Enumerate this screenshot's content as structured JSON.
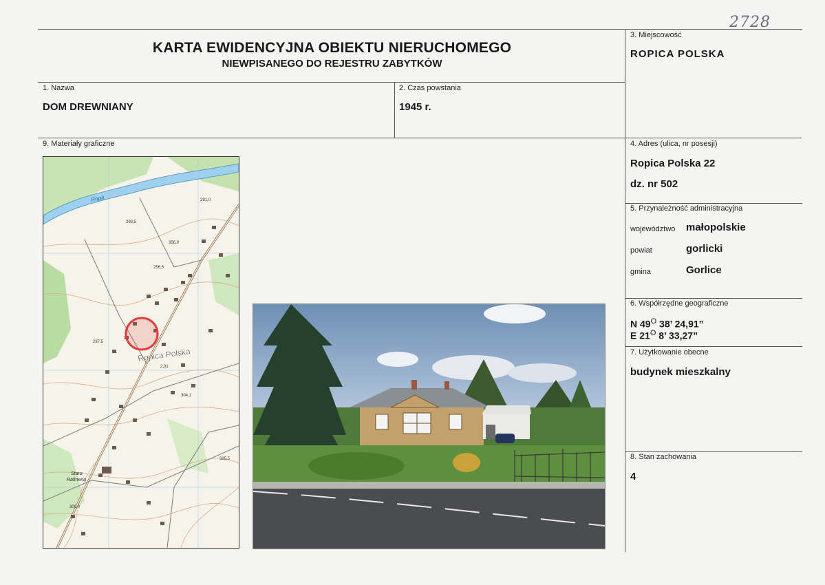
{
  "header": {
    "handwritten_number": "2728",
    "title_line1": "KARTA EWIDENCYJNA OBIEKTU NIERUCHOMEGO",
    "title_line2": "NIEWPISANEGO DO REJESTRU ZABYTKÓW"
  },
  "fields": {
    "miejscowosc": {
      "label": "3. Miejscowość",
      "value": "ROPICA POLSKA"
    },
    "nazwa": {
      "label": "1. Nazwa",
      "value": "DOM DREWNIANY"
    },
    "czas_powstania": {
      "label": "2. Czas powstania",
      "value": "1945 r."
    },
    "materialy": {
      "label": "9. Materiały graficzne"
    },
    "adres": {
      "label": "4. Adres (ulica, nr posesji)",
      "line1": "Ropica Polska 22",
      "line2": "dz. nr 502"
    },
    "przynaleznosc": {
      "label": "5. Przynależność administracyjna",
      "wojewodztwo_label": "województwo",
      "wojewodztwo": "małopolskie",
      "powiat_label": "powiat",
      "powiat": "gorlicki",
      "gmina_label": "gmina",
      "gmina": "Gorlice"
    },
    "wspolrzedne": {
      "label": "6. Współrzędne geograficzne",
      "n_prefix": "N 49",
      "n_deg": "O",
      "n_rest": " 38’ 24,91”",
      "e_prefix": "E 21",
      "e_deg": "O",
      "e_rest": " 8’ 33,27”"
    },
    "uzytkowanie": {
      "label": "7. Użytkowanie obecne",
      "value": "budynek mieszkalny"
    },
    "stan": {
      "label": "8. Stan zachowania",
      "value": "4"
    }
  },
  "map": {
    "place_label": "Ropica Polska",
    "river_label": "Ropa",
    "area_label_1": "Stara",
    "area_label_2": "Rafineria",
    "spot_heights": [
      "291,0",
      "293,5",
      "356,9",
      "256,5",
      "297,5",
      "304,1",
      "325,5",
      "309,0",
      "2,01"
    ]
  },
  "colors": {
    "marker": "#e23b3b",
    "road": "#8a6a5a",
    "contour": "#c9a07a",
    "water": "#8fc6e8",
    "forest": "#b7dca0"
  }
}
